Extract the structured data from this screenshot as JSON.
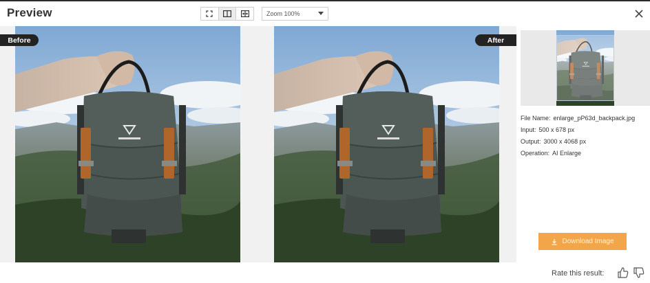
{
  "header": {
    "title": "Preview",
    "zoom": {
      "selected": "Zoom 100%"
    },
    "view_modes": [
      {
        "name": "fullscreen-icon",
        "active": false
      },
      {
        "name": "split-view-icon",
        "active": true
      },
      {
        "name": "compare-slider-icon",
        "active": false
      }
    ]
  },
  "before": {
    "label": "Before"
  },
  "after": {
    "label": "After"
  },
  "details": {
    "file_name_label": "File Name:",
    "file_name": "enlarge_pP63d_backpack.jpg",
    "input_label": "Input:",
    "input": "500 x 678 px",
    "output_label": "Output:",
    "output": "3000 x 4068 px",
    "operation_label": "Operation:",
    "operation": "AI Enlarge"
  },
  "download": {
    "label": "Download Image"
  },
  "rating": {
    "label": "Rate this result:"
  },
  "colors": {
    "accent": "#f3a649",
    "tag_bg": "#232323",
    "backpack": "#4b5552",
    "leather": "#b0652b"
  }
}
